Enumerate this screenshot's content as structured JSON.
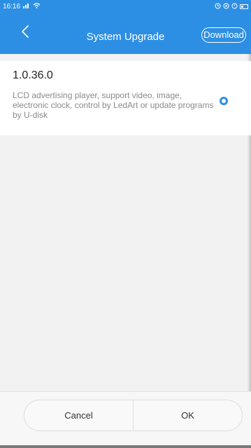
{
  "status_bar": {
    "time": "16:16",
    "signal_icon": "signal-icon",
    "wifi_icon": "wifi-icon",
    "alarm_icon": "alarm-icon",
    "battery_icon": "battery-icon"
  },
  "header": {
    "title": "System Upgrade",
    "download_label": "Download",
    "back_icon": "chevron-left-icon"
  },
  "firmware": {
    "version": "1.0.36.0",
    "description": "LCD advertising player, support video, image, electronic clock, control by LedArt or update programs by U-disk",
    "selected": true
  },
  "footer": {
    "cancel_label": "Cancel",
    "ok_label": "OK"
  },
  "colors": {
    "accent": "#2d8fe3",
    "background": "#f2f2f2"
  }
}
